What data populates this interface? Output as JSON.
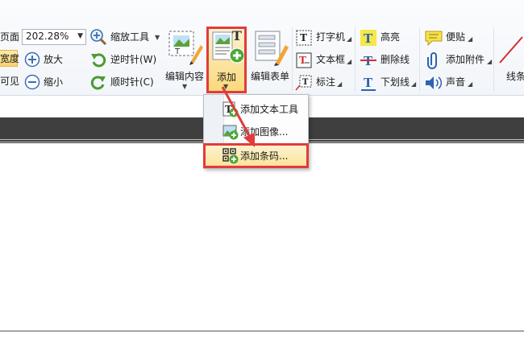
{
  "toolbar": {
    "left_col": {
      "page_label": "页面",
      "width_label": "宽度",
      "visible_label": "可见",
      "zoom_value": "202.28%"
    },
    "zoom_tools": {
      "zoom_tool_label": "缩放工具",
      "zoom_in_label": "放大",
      "zoom_out_label": "缩小"
    },
    "rotate": {
      "ccw_label": "逆时针(W)",
      "cw_label": "顺时针(C)"
    },
    "edit_content_label": "编辑内容",
    "add_label": "添加",
    "edit_form_label": "编辑表单",
    "text_tools": {
      "typewriter_label": "打字机",
      "textbox_label": "文本框",
      "callout_label": "标注"
    },
    "markup": {
      "highlight_label": "高亮",
      "strikeout_label": "删除线",
      "underline_label": "下划线"
    },
    "attach": {
      "sticky_label": "便贴",
      "attach_file_label": "添加附件",
      "sound_label": "声音"
    },
    "lines_label": "线条"
  },
  "add_menu": {
    "items": [
      {
        "label": "添加文本工具"
      },
      {
        "label": "添加图像..."
      },
      {
        "label": "添加条码..."
      }
    ]
  },
  "colors": {
    "annotation_red": "#e03c3c",
    "highlight_yellow": "#fbd97b",
    "doc_band": "#3f3f3f"
  }
}
